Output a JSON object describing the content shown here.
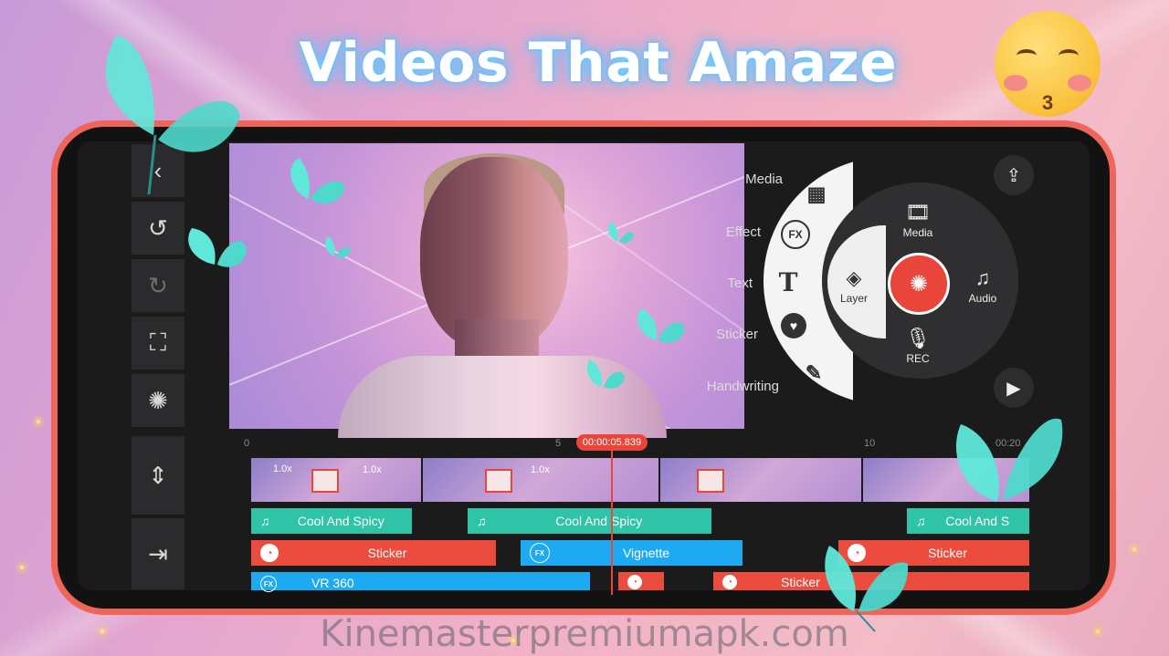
{
  "headline": "Videos That Amaze",
  "footer_watermark": "Kinemasterpremiumapk.com",
  "colors": {
    "accent_red": "#e9453b",
    "audio_teal": "#2fc4a7",
    "sticker_red": "#ec4c3e",
    "effect_blue": "#1eaaf2",
    "phone_border": "#f0655a",
    "butterfly": "#5fe8d9"
  },
  "left_toolbar": [
    {
      "name": "back",
      "icon": "chevron-left-icon",
      "glyph": "‹"
    },
    {
      "name": "undo",
      "icon": "undo-icon",
      "glyph": "↺"
    },
    {
      "name": "redo",
      "icon": "redo-icon",
      "glyph": "↻"
    },
    {
      "name": "capture",
      "icon": "capture-frame-icon",
      "glyph": "⛶"
    },
    {
      "name": "settings",
      "icon": "gear-icon",
      "glyph": "✺"
    },
    {
      "name": "adjust",
      "icon": "split-adjust-icon",
      "glyph": "⇕"
    },
    {
      "name": "exit",
      "icon": "exit-icon",
      "glyph": "⇥"
    }
  ],
  "media_menu": {
    "items": [
      {
        "label": "Media",
        "icon": "media-browser-icon"
      },
      {
        "label": "Effect",
        "icon": "fx-icon"
      },
      {
        "label": "Text",
        "icon": "text-t-icon"
      },
      {
        "label": "Sticker",
        "icon": "sticker-icon"
      },
      {
        "label": "Handwriting",
        "icon": "brush-icon"
      }
    ]
  },
  "wheel": {
    "top": {
      "label": "Media",
      "icon": "film-icon"
    },
    "left": {
      "label": "Layer",
      "icon": "layers-icon"
    },
    "right": {
      "label": "Audio",
      "icon": "music-note-icon"
    },
    "bottom": {
      "label": "REC",
      "icon": "microphone-icon"
    },
    "center": {
      "icon": "record-shutter-icon"
    }
  },
  "export_icon": "share-export-icon",
  "play_icon": "play-icon",
  "timeline": {
    "current_time": "00:00:05.839",
    "ruler_labels": [
      "0",
      "5",
      "10",
      "00:20"
    ],
    "clip_speeds": [
      "1.0x",
      "1.0x",
      "1.0x"
    ],
    "audio_tracks": [
      "Cool And Spicy",
      "Cool And Spicy",
      "Cool And S"
    ],
    "sticker_tracks": [
      "Sticker",
      "Sticker",
      "Sticker"
    ],
    "effect_tracks": [
      "Vignette",
      "VR 360"
    ]
  }
}
